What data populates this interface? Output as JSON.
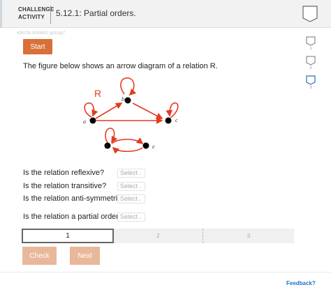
{
  "header": {
    "type_label_line1": "CHALLENGE",
    "type_label_line2": "ACTIVITY",
    "title": "5.12.1: Partial orders."
  },
  "activity_id": "498238.3049652.qx3zqy7",
  "start_label": "Start",
  "levels": [
    {
      "num": "1"
    },
    {
      "num": "2"
    },
    {
      "num": "3"
    }
  ],
  "prompt": "The figure below shows an arrow diagram of a relation R.",
  "diagram": {
    "relation_label": "R",
    "nodes": [
      "a",
      "b",
      "c",
      "d",
      "e"
    ],
    "colors": {
      "arrow": "#e63a1e",
      "node": "#000000"
    }
  },
  "questions": [
    {
      "label": "Is the relation reflexive?",
      "selected": "Select"
    },
    {
      "label": "Is the relation transitive?",
      "selected": "Select"
    },
    {
      "label": "Is the relation anti-symmetric?",
      "selected": "Select"
    },
    {
      "label": "Is the relation a partial order?",
      "selected": "Select"
    }
  ],
  "progress": {
    "steps": [
      "1",
      "2",
      "3"
    ],
    "current": 1
  },
  "buttons": {
    "check": "Check",
    "next": "Next"
  },
  "feedback_label": "Feedback?",
  "colors": {
    "accent": "#d9703a",
    "link": "#1a73c9",
    "disabled_button": "#e9b89a"
  }
}
